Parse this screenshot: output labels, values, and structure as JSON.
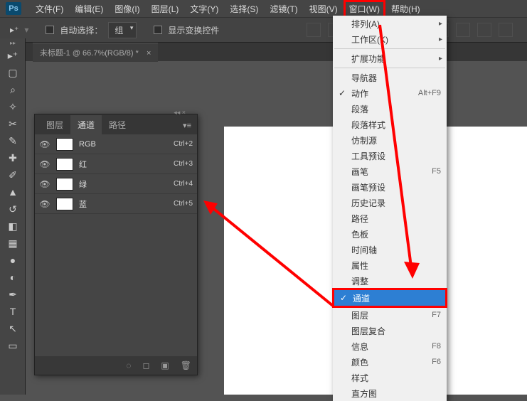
{
  "logo": "Ps",
  "menubar": {
    "file": "文件(F)",
    "edit": "编辑(E)",
    "image": "图像(I)",
    "layer": "图层(L)",
    "type": "文字(Y)",
    "select": "选择(S)",
    "filter": "滤镜(T)",
    "view": "视图(V)",
    "window": "窗口(W)",
    "help": "帮助(H)"
  },
  "optionsbar": {
    "auto_select": "自动选择：",
    "group": "组",
    "show_transform": "显示变换控件"
  },
  "doc_tab": {
    "title": "未标题-1 @ 66.7%(RGB/8) *",
    "close": "×"
  },
  "channels_panel": {
    "tabs": {
      "layers": "图层",
      "channels": "通道",
      "paths": "路径"
    },
    "rows": [
      {
        "name": "RGB",
        "shortcut": "Ctrl+2"
      },
      {
        "name": "红",
        "shortcut": "Ctrl+3"
      },
      {
        "name": "绿",
        "shortcut": "Ctrl+4"
      },
      {
        "name": "蓝",
        "shortcut": "Ctrl+5"
      }
    ]
  },
  "window_menu": {
    "arrange": "排列(A)",
    "workspace": "工作区(K)",
    "extensions": "扩展功能",
    "navigator": "导航器",
    "actions": "动作",
    "actions_sc": "Alt+F9",
    "paragraph": "段落",
    "para_styles": "段落样式",
    "clone": "仿制源",
    "presets": "工具预设",
    "brush": "画笔",
    "brush_sc": "F5",
    "brush_presets": "画笔预设",
    "history": "历史记录",
    "paths": "路径",
    "swatches": "色板",
    "timeline": "时间轴",
    "properties": "属性",
    "adjustments": "调整",
    "channels": "通道",
    "layers": "图层",
    "layers_sc": "F7",
    "layer_comps": "图层复合",
    "info": "信息",
    "info_sc": "F8",
    "color": "颜色",
    "color_sc": "F6",
    "styles": "样式",
    "histogram": "直方图"
  }
}
